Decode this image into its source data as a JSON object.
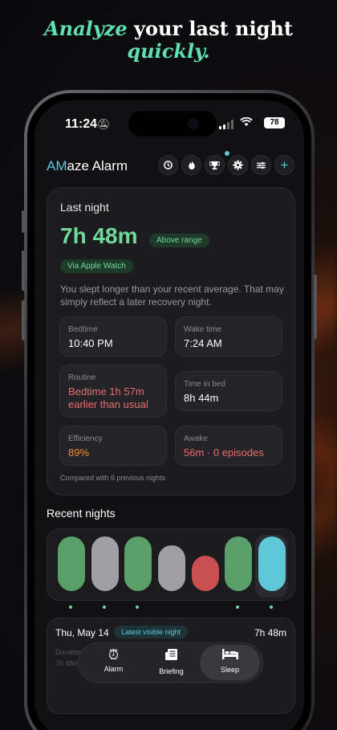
{
  "headline": {
    "accent1": "Analyze",
    "rest1": " your last night",
    "accent2": "quickly."
  },
  "status_bar": {
    "time": "11:24",
    "battery": "78"
  },
  "header": {
    "brand_accent": "AM",
    "brand_rest": "aze Alarm",
    "icons": [
      "history-icon",
      "flame-icon",
      "trophy-icon",
      "gear-icon",
      "sliders-icon",
      "plus-icon"
    ]
  },
  "last_night": {
    "title": "Last night",
    "duration": "7h 48m",
    "range_badge": "Above range",
    "source_badge": "Via Apple Watch",
    "description": "You slept longer than your recent average. That may simply reflect a later recovery night.",
    "tiles": {
      "bedtime_label": "Bedtime",
      "bedtime_value": "10:40 PM",
      "wake_label": "Wake time",
      "wake_value": "7:24 AM",
      "routine_label": "Routine",
      "routine_value": "Bedtime 1h 57m earlier than usual",
      "inbed_label": "Time in bed",
      "inbed_value": "8h 44m",
      "efficiency_label": "Efficiency",
      "efficiency_value": "89%",
      "awake_label": "Awake",
      "awake_value": "56m · 0 episodes"
    },
    "footnote": "Compared with 6 previous nights"
  },
  "recent_nights": {
    "title": "Recent nights",
    "bar_colors": [
      "#5a9e6a",
      "#a0a0a4",
      "#5a9e6a",
      "#a0a0a4",
      "#c85050",
      "#5a9e6a",
      "#5ec8d8"
    ],
    "dots": [
      true,
      true,
      true,
      false,
      false,
      true,
      true
    ]
  },
  "night_detail": {
    "date": "Thu, May 14",
    "badge": "Latest visible night",
    "duration": "7h 48m",
    "faded_label": "Duration",
    "faded_value": "7h 48m"
  },
  "tabbar": {
    "alarm": "Alarm",
    "briefing": "Briefing",
    "sleep": "Sleep"
  }
}
